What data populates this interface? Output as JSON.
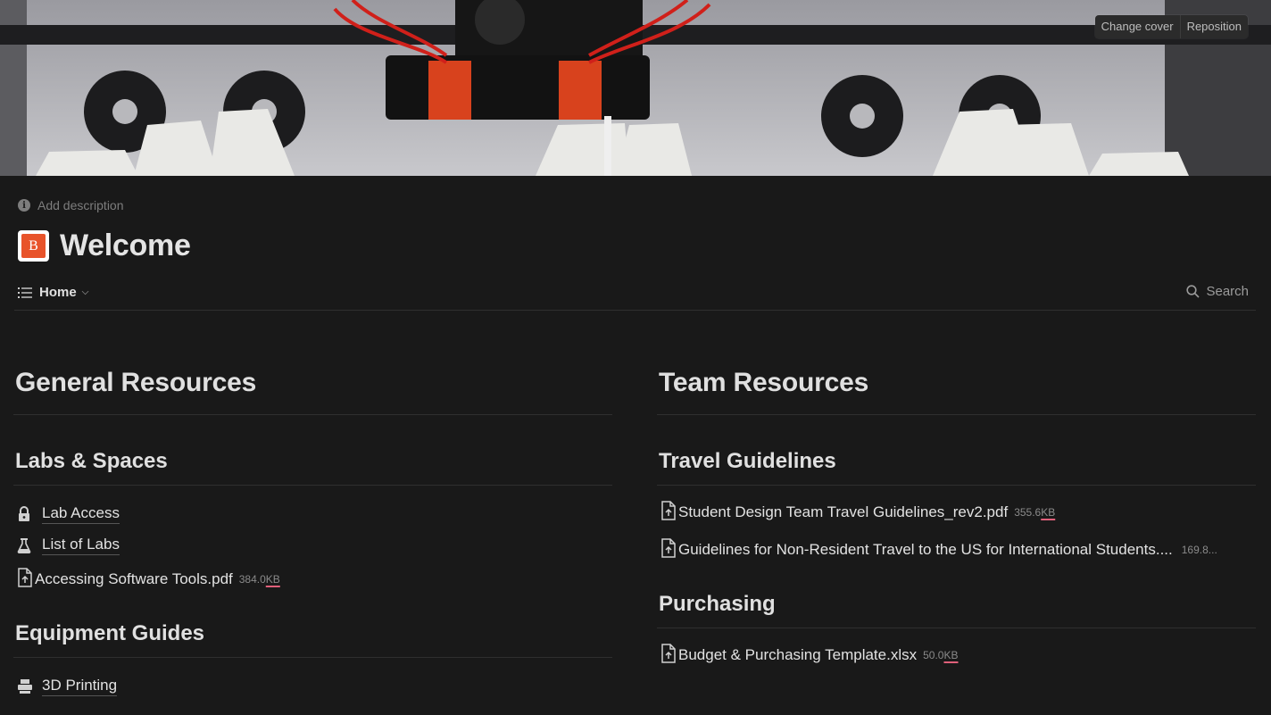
{
  "cover": {
    "change_label": "Change cover",
    "reposition_label": "Reposition"
  },
  "header": {
    "add_description": "Add description",
    "icon_letters": "B",
    "title": "Welcome"
  },
  "view_bar": {
    "tab_label": "Home",
    "search_label": "Search"
  },
  "general": {
    "heading": "General Resources",
    "labs_heading": "Labs & Spaces",
    "lab_access": "Lab Access",
    "list_of_labs": "List of Labs",
    "software_file": {
      "name": "Accessing Software Tools.pdf",
      "size": "384.0",
      "unit": "KB"
    },
    "equipment_heading": "Equipment Guides",
    "printing": "3D Printing"
  },
  "team": {
    "heading": "Team Resources",
    "travel_heading": "Travel Guidelines",
    "travel_files": [
      {
        "name": "Student Design Team Travel Guidelines_rev2.pdf",
        "size": "355.6",
        "unit": "KB"
      },
      {
        "name": "Guidelines for Non-Resident Travel to the US for International Students....",
        "size": "169.8...",
        "unit": ""
      }
    ],
    "purchasing_heading": "Purchasing",
    "purchasing_file": {
      "name": "Budget & Purchasing Template.xlsx",
      "size": "50.0",
      "unit": "KB"
    }
  },
  "colors": {
    "background": "#191919",
    "accent_icon": "#e8532a",
    "kb_underline": "#e0607a"
  }
}
